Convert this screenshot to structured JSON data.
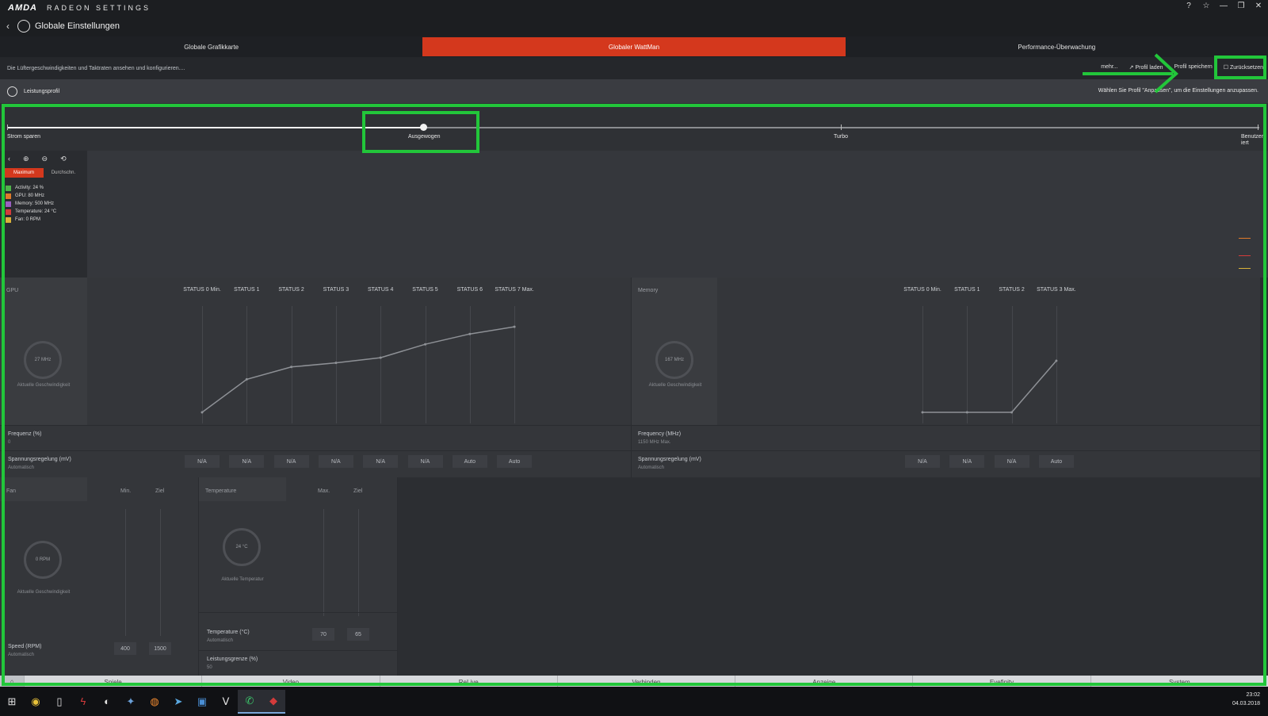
{
  "window": {
    "brand": "AMDA",
    "app_title": "RADEON SETTINGS",
    "controls": [
      "?",
      "☆",
      "—",
      "❐",
      "✕"
    ]
  },
  "nav": {
    "title": "Globale Einstellungen"
  },
  "tabs": [
    "Globale Grafikkarte",
    "Globaler WattMan",
    "Performance-Überwachung"
  ],
  "info": {
    "description": "Die Lüftergeschwindigkeiten und Taktraten ansehen und konfigurieren....",
    "more": "mehr...",
    "load_profile": "Profil laden",
    "save_profile": "Profil speichern",
    "reset": "Zurücksetzen"
  },
  "profile": {
    "label": "Leistungsprofil",
    "hint": "Wählen Sie Profil \"Anpassen\", um die Einstellungen anzupassen."
  },
  "slider": {
    "options": [
      "Strom sparen",
      "Ausgewogen",
      "Turbo",
      "Benutzerdefiniert"
    ],
    "last_label_lines": [
      "Benutzer",
      "iert"
    ],
    "selected_index": 1
  },
  "monitor": {
    "views": [
      "Maximum",
      "Durchschn."
    ],
    "legend": [
      {
        "label": "Activity: 24 %",
        "color": "#4fb34a"
      },
      {
        "label": "GPU: 80 MHz",
        "color": "#e07a2a"
      },
      {
        "label": "Memory: 500 MHz",
        "color": "#9a5fc0"
      },
      {
        "label": "Temperature: 24 °C",
        "color": "#d43b3b"
      },
      {
        "label": "Fan: 0 RPM",
        "color": "#d9b23a"
      }
    ]
  },
  "gpu": {
    "title": "GPU",
    "states": [
      "STATUS 0 Min.",
      "STATUS 1",
      "STATUS 2",
      "STATUS 3",
      "STATUS 4",
      "STATUS 5",
      "STATUS 6",
      "STATUS 7 Max."
    ],
    "dial_value": "27 MHz",
    "dial_caption": "Aktuelle Geschwindigkeit",
    "freq_label": "Frequenz (%)",
    "freq_value": "0",
    "volt_label": "Spannungsregelung (mV)",
    "volt_mode": "Automatisch",
    "volt_values": [
      "N/A",
      "N/A",
      "N/A",
      "N/A",
      "N/A",
      "N/A",
      "Auto",
      "Auto"
    ],
    "curve": [
      0,
      0.32,
      0.44,
      0.48,
      0.53,
      0.66,
      0.76,
      0.83
    ]
  },
  "memory": {
    "title": "Memory",
    "states": [
      "STATUS 0 Min.",
      "STATUS 1",
      "STATUS 2",
      "STATUS 3 Max."
    ],
    "dial_value": "167 MHz",
    "dial_caption": "Aktuelle Geschwindigkeit",
    "freq_label": "Frequency (MHz)",
    "freq_value": "1150 MHz Max.",
    "volt_label": "Spannungsregelung (mV)",
    "volt_mode": "Automatisch",
    "volt_values": [
      "N/A",
      "N/A",
      "N/A",
      "Auto"
    ],
    "curve": [
      0,
      0,
      0,
      0.5
    ]
  },
  "fan": {
    "title": "Fan",
    "col_min": "Min.",
    "col_target": "Ziel",
    "dial_value": "0 RPM",
    "dial_caption": "Aktuelle Geschwindigkeit",
    "speed_label": "Speed (RPM)",
    "speed_mode": "Automatisch",
    "speed_min": "400",
    "speed_target": "1500"
  },
  "temperature": {
    "title": "Temperature",
    "col_max": "Max.",
    "col_target": "Ziel",
    "dial_value": "24 °C",
    "dial_caption": "Aktuelle Temperatur",
    "temp_label": "Temperature (°C)",
    "temp_mode": "Automatisch",
    "temp_max": "70",
    "temp_target": "65",
    "power_label": "Leistungsgrenze (%)",
    "power_value": "50"
  },
  "bottom_nav": [
    "Spiele",
    "Video",
    "ReLive",
    "Verbinden",
    "Anzeige",
    "Eyefinity",
    "System"
  ],
  "taskbar": {
    "icons": [
      "windows-icon",
      "chrome-icon",
      "file-icon",
      "flash-icon",
      "steam-icon",
      "app-icon",
      "origin-icon",
      "telegram-icon",
      "outlook-icon",
      "wings-icon",
      "whatsapp-icon",
      "amd-icon"
    ],
    "time": "23:02",
    "date": "04.03.2018"
  },
  "annotations": {
    "color": "#22c63a"
  }
}
